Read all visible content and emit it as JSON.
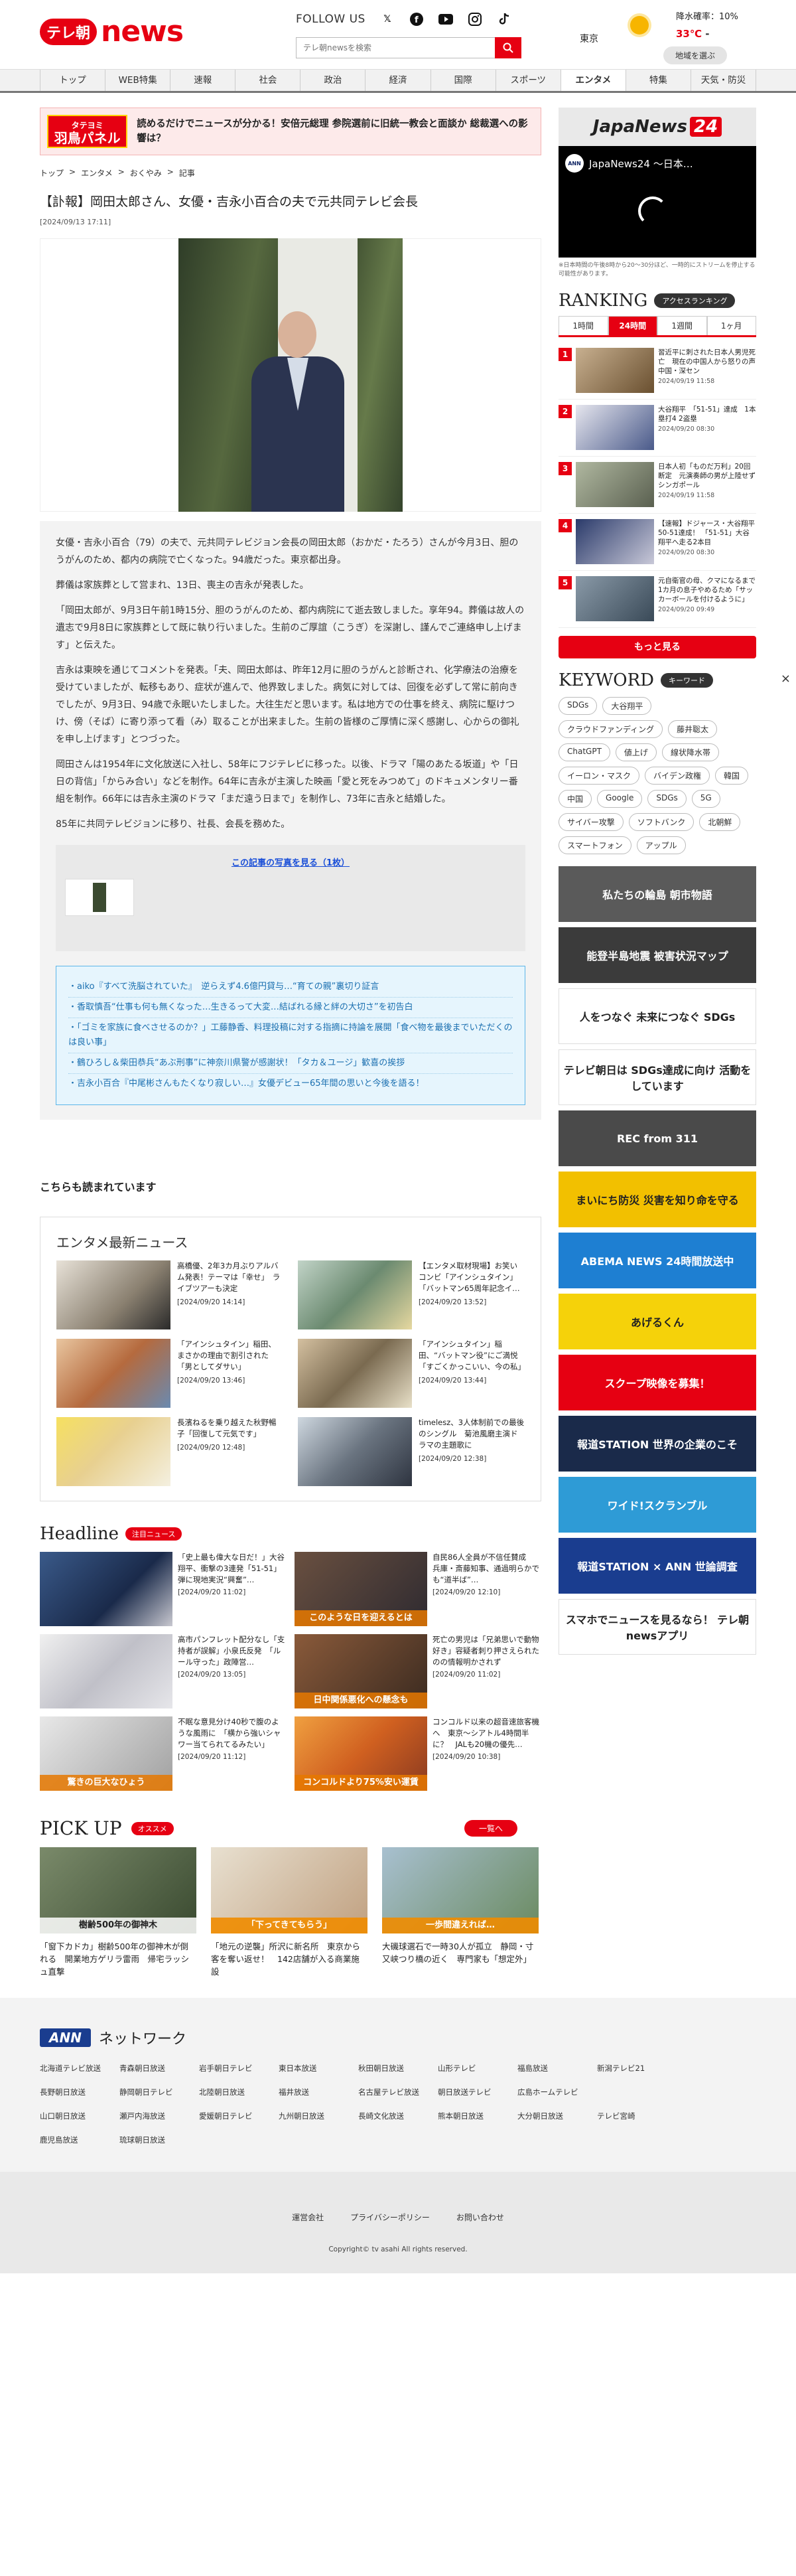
{
  "header": {
    "logo_badge": "テレ朝",
    "logo_news": "news",
    "follow_label": "FOLLOW US",
    "search_placeholder": "テレ朝newsを検索",
    "weather": {
      "city": "東京",
      "rain": "降水確率：10%",
      "temp": "33℃",
      "temp_sep": "-",
      "region_button": "地域を選ぶ"
    }
  },
  "nav": [
    "トップ",
    "WEB特集",
    "速報",
    "社会",
    "政治",
    "経済",
    "国際",
    "スポーツ",
    "エンタメ",
    "特集",
    "天気・防災"
  ],
  "banner": {
    "logo_top": "タテヨミ",
    "logo_main": "羽鳥パネル",
    "text": "読めるだけでニュースが分かる！安倍元総理 参院選前に旧統一教会と面談か 総裁選への影響は？"
  },
  "breadcrumbs": [
    "トップ",
    "エンタメ",
    "おくやみ",
    "記事"
  ],
  "article": {
    "title": "【訃報】岡田太郎さん、女優・吉永小百合の夫で元共同テレビ会長",
    "date": "[2024/09/13 17:11]",
    "paragraphs": [
      "女優・吉永小百合（79）の夫で、元共同テレビジョン会長の岡田太郎（おかだ・たろう）さんが今月3日、胆のうがんのため、都内の病院で亡くなった。94歳だった。東京都出身。",
      "葬儀は家族葬として営まれ、13日、喪主の吉永が発表した。",
      "「岡田太郎が、9月3日午前1時15分、胆のうがんのため、都内病院にて逝去致しました。享年94。葬儀は故人の遺志で9月8日に家族葬として既に執り行いました。生前のご厚誼（こうぎ）を深謝し、謹んでご連絡申し上げます」と伝えた。",
      "吉永は東映を通じてコメントを発表。「夫、岡田太郎は、昨年12月に胆のうがんと診断され、化学療法の治療を受けていましたが、転移もあり、症状が進んで、他界致しました。病気に対しては、回復を必ずして常に前向きでしたが、9月3日、94歳で永眠いたしました。大往生だと思います。私は地方での仕事を終え、病院に駆けつけ、傍（そば）に寄り添って看（み）取ることが出来ました。生前の皆様のご厚情に深く感謝し、心からの御礼を申し上げます」とつづった。",
      "岡田さんは1954年に文化放送に入社し、58年にフジテレビに移った。以後、ドラマ「陽のあたる坂道」や「日日の背信」「からみ合い」などを制作。64年に吉永が主演した映画「愛と死をみつめて」のドキュメンタリー番組を制作。66年には吉永主演のドラマ「まだ遠う日まで」を制作し、73年に吉永と結婚した。",
      "85年に共同テレビジョンに移り、社長、会長を務めた。"
    ],
    "more_photos": "この記事の写真を見る（1枚）",
    "related": [
      "・aiko『すべて洗脳されていた』　逆らえず4.6億円貸与…“育ての親”裏切り証言",
      "・香取慎吾“仕事も何も無くなった…生きるって大変…結ばれる縁と絆の大切さ”を初告白",
      "・「ゴミを家族に食べさせるのか？」工藤静香、料理投稿に対する指摘に持論を展開「食べ物を最後までいただくのは良い事」",
      "・鶴ひろし＆柴田恭兵“あぶ刑事”に神奈川県警が感謝状！「タカ＆ユージ」歓喜の挨拶",
      "・吉永小百合『中尾彬さんもたくなり寂しい…』女優デビュー65年間の思いと今後を語る！"
    ]
  },
  "also_read": "こちらも読まれています",
  "ent_news": {
    "title": "エンタメ最新ニュース",
    "items": [
      {
        "text": "高橋優、2年3カ月ぶりアルバム発表！テーマは「幸せ」　ライブツアーも決定",
        "time": "[2024/09/20 14:14]"
      },
      {
        "text": "【エンタメ取材現場】お笑いコンビ「アインシュタイン」　「バットマン65周年記念イ…",
        "time": "[2024/09/20 13:52]"
      },
      {
        "text": "「アインシュタイン」稲田、まさかの理由で割引された「男としてダサい」",
        "time": "[2024/09/20 13:46]"
      },
      {
        "text": "「アインシュタイン」稲田、“バットマン役”にご満悦「すごくかっこいい、今の私」",
        "time": "[2024/09/20 13:44]"
      },
      {
        "text": "長濱ねるを乗り越えた秋野暢子「回復して元気です」",
        "time": "[2024/09/20 12:48]"
      },
      {
        "text": "timelesz、3人体制前での最後のシングル　菊池風磨主演ドラマの主題歌に",
        "time": "[2024/09/20 12:38]"
      }
    ]
  },
  "headline": {
    "title": "Headline",
    "tag": "注目ニュース",
    "items": [
      {
        "text": "「史上最も偉大な日だ！」大谷翔平、衝撃の3連発「51-51」弾に現地実況“興奮”…",
        "time": "[2024/09/20 11:02]",
        "caption": ""
      },
      {
        "text": "自民86人全員が不信任賛成　兵庫・斎藤知事、通過明らかでも“道半ば”…",
        "time": "[2024/09/20 12:10]",
        "caption": "このような日を迎えるとは"
      },
      {
        "text": "高市パンフレット配分なし「支持者が誤解」小泉氏反発　「ルール守った」政陣営…",
        "time": "[2024/09/20 13:05]",
        "caption": ""
      },
      {
        "text": "死亡の男児は「兄弟思いで動物好き」容疑者刺り押さえられたのの情報明かされず",
        "time": "[2024/09/20 11:02]",
        "caption": "日中関係悪化への懸念も"
      },
      {
        "text": "不眠な意見分け40秒で腹のような風雨に　「横から強いシャワー当てられてるみたい」",
        "time": "[2024/09/20 11:12]",
        "caption": "驚きの巨大なひょう"
      },
      {
        "text": "コンコルド以来の超音速旅客機へ　東京〜シアトル4時間半に？　JALも20機の優先…",
        "time": "[2024/09/20 10:38]",
        "caption": "コンコルドより75%安い運賃"
      }
    ]
  },
  "pickup": {
    "title": "PICK UP",
    "tag": "オススメ",
    "all_button": "一覧へ",
    "items": [
      {
        "text": "「窗下カドカ」樹齢500年の御神木が倒れる　開業地方ゲリラ雷雨　帰宅ラッシュ直撃",
        "caption": "樹齢500年の御神木"
      },
      {
        "text": "「地元の逆襲」所沢に新名所　東京から客を奪い返せ！　142店舗が入る商業施設",
        "caption": "「下ってきてもらう」"
      },
      {
        "text": "大磯球選石で一時30人が孤立　静岡・寸又峡つり橋の近く　専門家も「想定外」",
        "caption": "一歩間違えれば…"
      }
    ]
  },
  "sidebar": {
    "japannews_label": "JapaNews",
    "japannews_num": "24",
    "video_title": "JapaNews24 ～日本…",
    "video_channel": "ANN",
    "video_note": "※日本時間の午後8時から20〜30分ほど、一時的にストリームを停止する可能性があります。",
    "ranking_title": "RANKING",
    "ranking_pill": "アクセスランキング",
    "ranking_tabs": [
      "1時間",
      "24時間",
      "1週間",
      "1ヶ月"
    ],
    "ranking_items": [
      {
        "num": "1",
        "text": "習近平に刺された日本人男児死亡　現在の中国人から怒りの声　中国・深セン",
        "time": "2024/09/19 11:58"
      },
      {
        "num": "2",
        "text": "大谷翔平　「51-51」達成　1本塁打4 2盗塁",
        "time": "2024/09/20 08:30"
      },
      {
        "num": "3",
        "text": "日本人初「ものだ万利」20回断定　元演奏師の男が上陸せず　シンガポール",
        "time": "2024/09/19 11:58"
      },
      {
        "num": "4",
        "text": "【速報】ドジャース・大谷翔平 50-51達成！ 「51-51」大谷翔平へ走る2本目",
        "time": "2024/09/20 08:30"
      },
      {
        "num": "5",
        "text": "元自衛官の母、クマになるまで　1カ月の息子やめるため「サッカーボールを付けるように」",
        "time": "2024/09/20 09:49"
      }
    ],
    "more_button": "もっと見る",
    "keyword_title": "KEYWORD",
    "keyword_pill": "キーワード",
    "keywords": [
      "SDGs",
      "大谷翔平",
      "クラウドファンディング",
      "藤井聡太",
      "ChatGPT",
      "値上げ",
      "線状降水帯",
      "イーロン・マスク",
      "バイデン政権",
      "韓国",
      "中国",
      "Google",
      "SDGs",
      "5G",
      "サイバー攻撃",
      "ソフトバンク",
      "北朝鮮",
      "スマートフォン",
      "アップル"
    ],
    "banners": [
      {
        "label": "私たちの輪島 朝市物語",
        "color": "#5a5a5a"
      },
      {
        "label": "能登半島地震 被害状況マップ",
        "color": "#3b3b3b"
      },
      {
        "label": "人をつなぐ 未来につなぐ SDGs",
        "color": "#ffffff"
      },
      {
        "label": "テレビ朝日は SDGs達成に向け 活動をしています",
        "color": "#ffffff"
      },
      {
        "label": "REC from 311",
        "color": "#4a4a4a"
      },
      {
        "label": "まいにち防災 災害を知り命を守る",
        "color": "#f2c000"
      },
      {
        "label": "ABEMA NEWS 24時間放送中",
        "color": "#1e7fd2"
      },
      {
        "label": "あげるくん",
        "color": "#f5d20a"
      },
      {
        "label": "スクープ映像を募集！",
        "color": "#e60012"
      },
      {
        "label": "報道STATION 世界の企業のこそ",
        "color": "#1a2a4a"
      },
      {
        "label": "ワイド!スクランブル",
        "color": "#2e9bd6"
      },
      {
        "label": "報道STATION × ANN 世論調査",
        "color": "#1a3d8f"
      },
      {
        "label": "スマホでニュースを見るなら！ テレ朝newsアプリ",
        "color": "#ffffff"
      }
    ]
  },
  "ann": {
    "logo": "ANN",
    "title": "ネットワーク",
    "stations": [
      "北海道テレビ放送",
      "青森朝日放送",
      "岩手朝日テレビ",
      "東日本放送",
      "秋田朝日放送",
      "山形テレビ",
      "福島放送",
      "新潟テレビ21",
      "",
      "長野朝日放送",
      "静岡朝日テレビ",
      "北陸朝日放送",
      "福井放送",
      "名古屋テレビ放送",
      "朝日放送テレビ",
      "広島ホームテレビ",
      "",
      "",
      "山口朝日放送",
      "瀬戸内海放送",
      "愛媛朝日テレビ",
      "九州朝日放送",
      "長崎文化放送",
      "熊本朝日放送",
      "大分朝日放送",
      "テレビ宮崎",
      "",
      "鹿児島放送",
      "琉球朝日放送"
    ]
  },
  "footer": {
    "links": [
      "運営会社",
      "プライバシーポリシー",
      "お問い合わせ"
    ],
    "copyright": "Copyright© tv asahi All rights reserved."
  }
}
